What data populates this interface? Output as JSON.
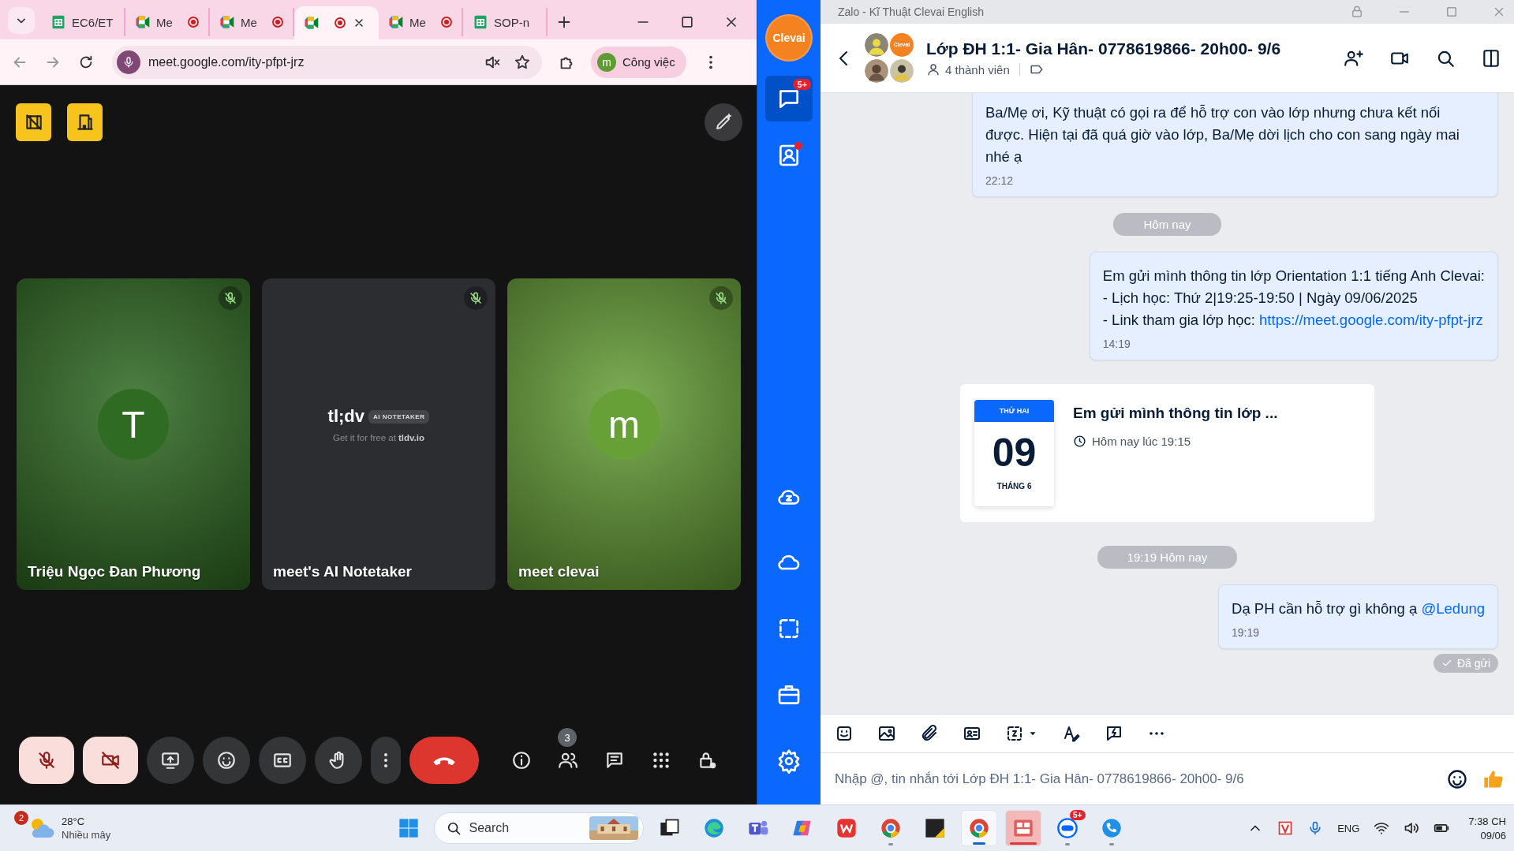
{
  "browser": {
    "tabs": [
      {
        "kind": "sheets",
        "label": "EC6/ET",
        "recording": false,
        "selected": false
      },
      {
        "kind": "meet",
        "label": "Me",
        "recording": true,
        "selected": false
      },
      {
        "kind": "meet",
        "label": "Me",
        "recording": true,
        "selected": false
      },
      {
        "kind": "meet",
        "recording": true,
        "selected": true
      },
      {
        "kind": "meet",
        "label": "Me",
        "recording": true,
        "selected": false
      },
      {
        "kind": "sheets",
        "label": "SOP-n",
        "recording": false,
        "selected": false
      }
    ],
    "address": "meet.google.com/ity-pfpt-jrz",
    "profile": {
      "initial": "m",
      "label": "Công việc"
    }
  },
  "meet": {
    "participants": [
      {
        "kind": "avatar",
        "name": "Triệu Ngọc Đan Phương",
        "initial": "T",
        "color": "#2f6b22",
        "muted": true
      },
      {
        "kind": "notetaker",
        "name": "meet's AI Notetaker",
        "logo": "tl;dv",
        "badge": "AI NOTETAKER",
        "tagline": "Get it for free at **tldv.io**",
        "muted": true
      },
      {
        "kind": "avatar",
        "name": "meet clevai",
        "initial": "m",
        "color": "#66a036",
        "muted": true
      }
    ],
    "mic_on": false,
    "camera_on": false,
    "people_count": "3"
  },
  "zalo": {
    "window_title": "Zalo - Kĩ Thuật Clevai English",
    "account": "Clevai",
    "nav": {
      "chat_badge": "5+",
      "chat_selected": true,
      "contacts_dot": true
    },
    "chat": {
      "title": "Lớp ĐH 1:1- Gia Hân- 0778619866- 20h00- 9/6",
      "avatar_label": "Clevai",
      "members": "4 thành viên"
    },
    "messages": [
      {
        "kind": "outgoing",
        "text": "Ba/Mẹ ơi, Kỹ thuật có gọi ra để hỗ trợ con vào lớp nhưng chưa kết nối được. Hiện tại đã quá giờ vào lớp, Ba/Mẹ dời lịch cho con sang ngày mai nhé ạ",
        "time": "22:12"
      },
      {
        "kind": "divider",
        "text": "Hôm nay"
      },
      {
        "kind": "outgoing",
        "text": "Em gửi mình thông tin lớp Orientation 1:1 tiếng Anh Clevai:\n - Lịch học: Thứ 2|19:25-19:50 | Ngày 09/06/2025\n - Link tham gia lớp học: ",
        "link": "https://meet.google.com/ity-pfpt-jrz",
        "time": "14:19"
      },
      {
        "kind": "event",
        "weekday": "THỨ HAI",
        "day": "09",
        "month": "THÁNG 6",
        "title": "Em gửi mình thông tin lớp ...",
        "when": "Hôm nay lúc 19:15"
      },
      {
        "kind": "divider",
        "text": "19:19 Hôm nay"
      },
      {
        "kind": "outgoing",
        "text": "Dạ PH cần hỗ trợ gì không ạ ",
        "link": "@Ledung",
        "time": "19:19"
      },
      {
        "kind": "status",
        "text": "Đã gửi"
      }
    ],
    "composer": {
      "placeholder": "Nhập @, tin nhắn tới Lớp ĐH 1:1- Gia Hân- 0778619866- 20h00- 9/6"
    }
  },
  "taskbar": {
    "weather": {
      "badge": "2",
      "temp": "28°C",
      "desc": "Nhiều mây"
    },
    "search": "Search",
    "apps": [
      {
        "kind": "taskview",
        "running": false,
        "selected": false
      },
      {
        "kind": "edge",
        "running": false,
        "selected": false
      },
      {
        "kind": "teams",
        "running": false,
        "selected": false
      },
      {
        "kind": "copilot",
        "running": false,
        "selected": false
      },
      {
        "kind": "wps",
        "running": false,
        "selected": false
      },
      {
        "kind": "chrome",
        "running": true,
        "selected": false
      },
      {
        "kind": "notes",
        "running": false,
        "selected": false
      },
      {
        "kind": "chrome",
        "running": true,
        "selected": true
      },
      {
        "kind": "redapp",
        "running": true,
        "selected": true
      },
      {
        "kind": "zalo",
        "running": true,
        "selected": false,
        "badge": "5+"
      },
      {
        "kind": "phone",
        "running": true,
        "selected": false
      }
    ],
    "language": "ENG",
    "time": "7:38 CH",
    "date": "09/06"
  }
}
